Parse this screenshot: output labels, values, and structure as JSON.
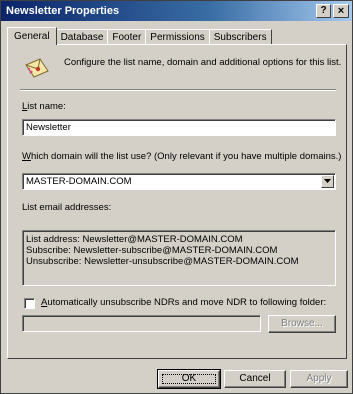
{
  "window": {
    "title": "Newsletter Properties",
    "help_glyph": "?",
    "close_glyph": "×"
  },
  "tabs": [
    {
      "label": "General",
      "active": true
    },
    {
      "label": "Database",
      "active": false
    },
    {
      "label": "Footer",
      "active": false
    },
    {
      "label": "Permissions",
      "active": false
    },
    {
      "label": "Subscribers",
      "active": false
    }
  ],
  "general": {
    "icon": "envelope-icon",
    "intro": "Configure the list name, domain and additional options for this list.",
    "list_name_label_u": "L",
    "list_name_label_rest": "ist name:",
    "list_name_value": "Newsletter",
    "domain_label_u": "W",
    "domain_label_rest": "hich domain will the list use? (Only relevant if you have multiple domains.)",
    "domain_value": "MASTER-DOMAIN.COM",
    "email_label": "List email addresses:",
    "addresses": [
      "List address: Newsletter@MASTER-DOMAIN.COM",
      "Subscribe: Newsletter-subscribe@MASTER-DOMAIN.COM",
      "Unsubscribe: Newsletter-unsubscribe@MASTER-DOMAIN.COM"
    ],
    "auto_unsub_checked": false,
    "auto_unsub_label_u": "A",
    "auto_unsub_label_rest": "utomatically unsubscribe NDRs and move NDR to following folder:",
    "folder_value": "",
    "browse_label": "Browse..."
  },
  "buttons": {
    "ok": "OK",
    "cancel": "Cancel",
    "apply": "Apply"
  },
  "colors": {
    "face": "#d4d0c8",
    "title_start": "#0a246a",
    "title_end": "#a6caf0"
  }
}
